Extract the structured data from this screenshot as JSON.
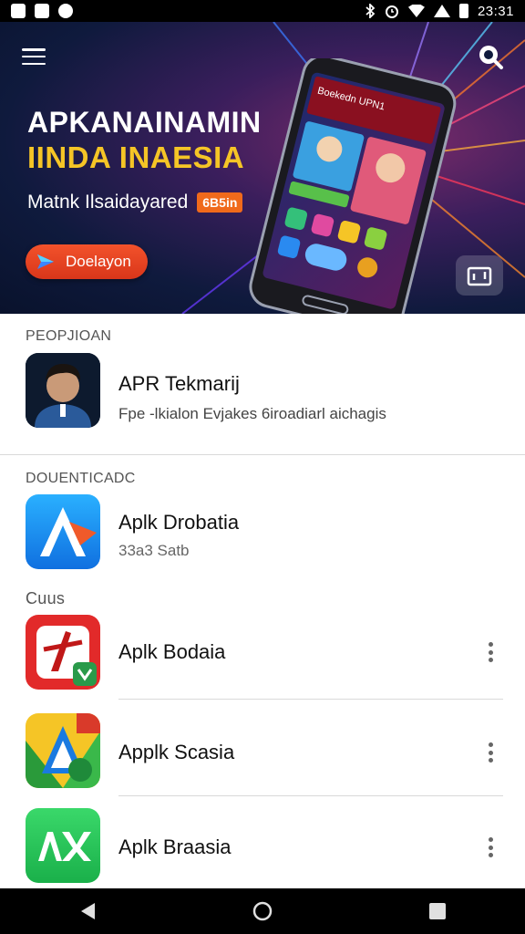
{
  "status_bar": {
    "time": "23:31",
    "icons": [
      "gallery-icon",
      "message-icon",
      "chat-icon",
      "bluetooth-icon",
      "alarm-icon",
      "wifi-icon",
      "signal-icon",
      "battery-icon"
    ]
  },
  "banner": {
    "title": "APKANAINAMIN",
    "subtitle": "IINDA INAESIA",
    "tagline": "Matnk Ilsaidayared",
    "badge": "6B5in",
    "cta_label": "Doelayon",
    "phone_screen_text": "Boekedn UPN1",
    "colors": {
      "title": "#ffffff",
      "subtitle": "#f5c526",
      "cta": "#e5431f",
      "badge": "#f06a1b"
    }
  },
  "sections": {
    "featured": {
      "label": "PEOPJIOAN",
      "app": {
        "title": "APR Tekmarij",
        "subtitle": "Fpe -lkialon Evjakes 6iroadiarl aichagis"
      }
    },
    "downloads": {
      "label": "DOUENTICADC",
      "app": {
        "title": "Aplk Drobatia",
        "subtitle": "33a3 Satb"
      }
    },
    "other": {
      "label": "Cuus",
      "apps": [
        {
          "title": "Aplk Bodaia"
        },
        {
          "title": "Applk Scasia"
        },
        {
          "title": "Aplk Braasia"
        }
      ]
    }
  },
  "nav_bar": {
    "items": [
      "back-icon",
      "home-icon",
      "recents-icon"
    ]
  }
}
